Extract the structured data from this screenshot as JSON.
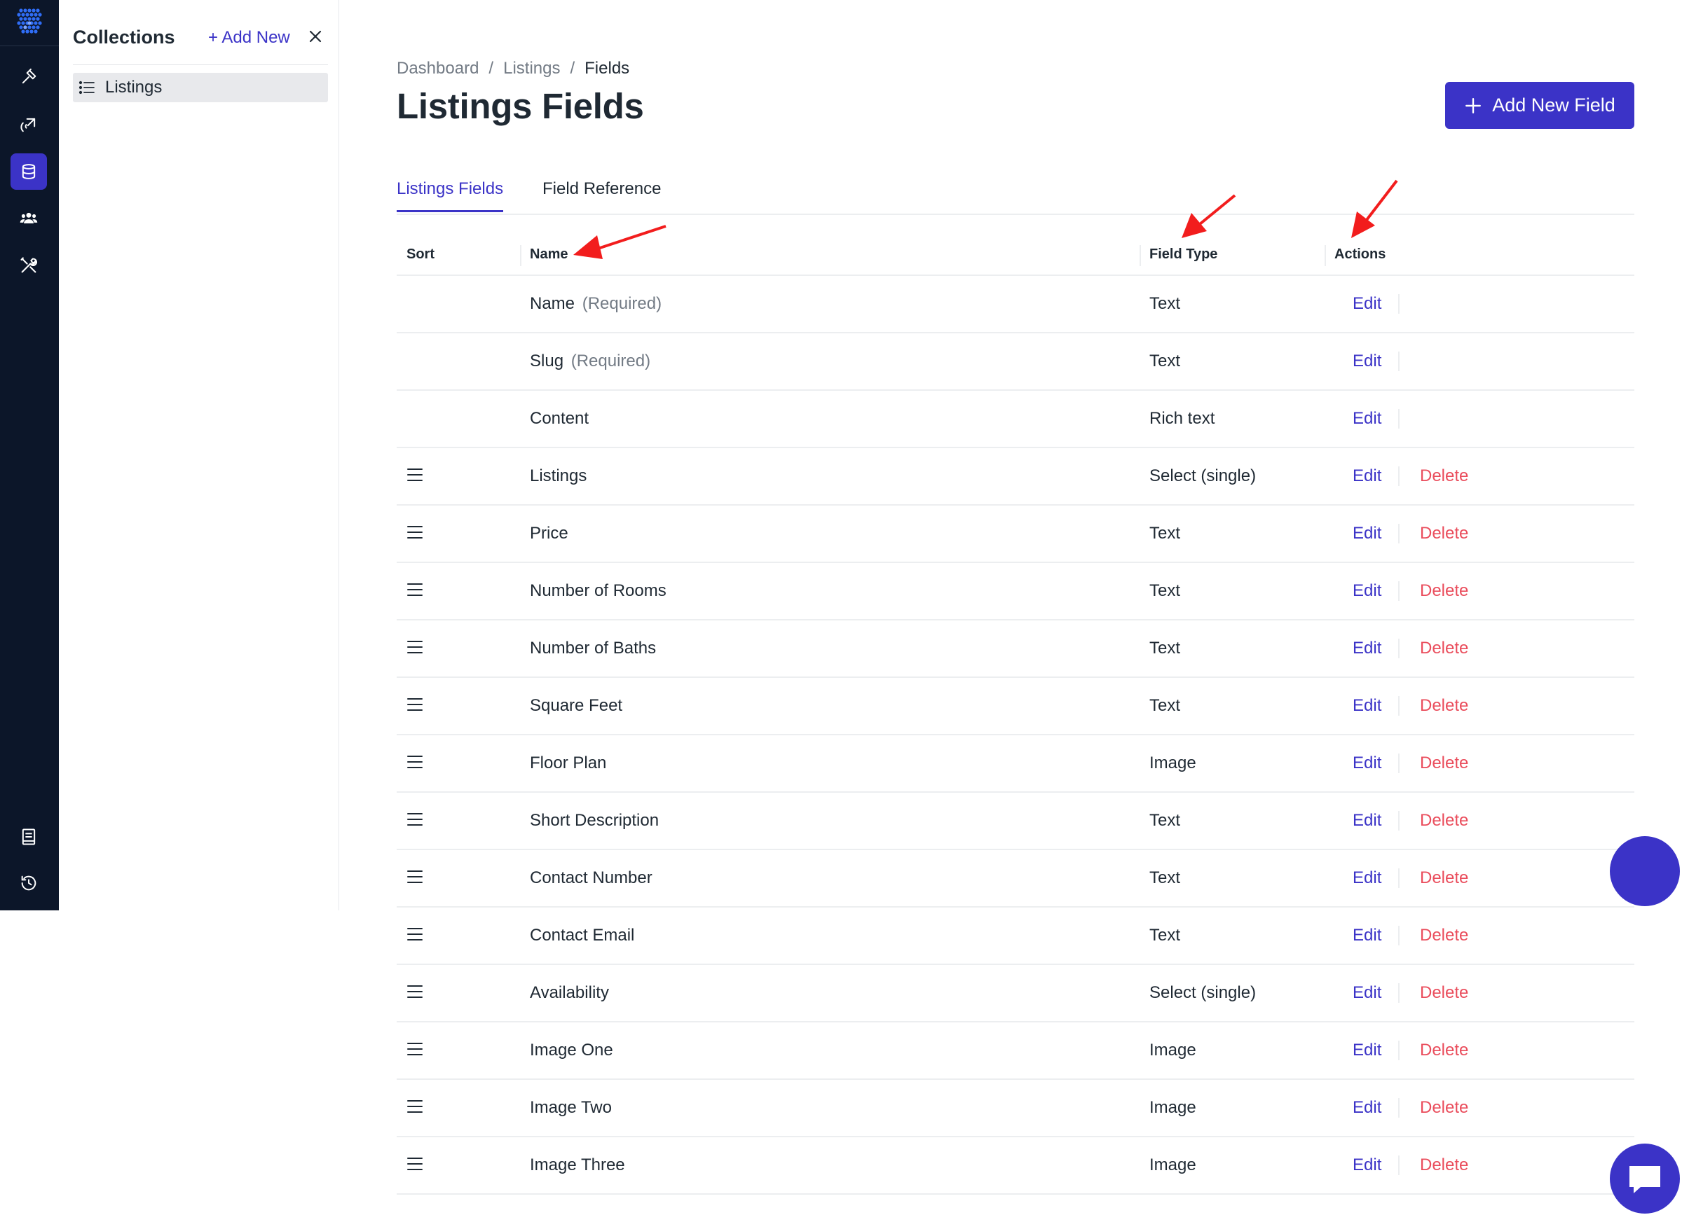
{
  "sidebar": {
    "title": "Collections",
    "add_label": "+ Add New",
    "items": [
      {
        "label": "Listings"
      }
    ]
  },
  "breadcrumb": [
    "Dashboard",
    "/",
    "Listings",
    "/",
    "Fields"
  ],
  "page": {
    "title": "Listings Fields",
    "add_button_label": "Add New Field"
  },
  "tabs": [
    {
      "label": "Listings Fields",
      "active": true
    },
    {
      "label": "Field Reference",
      "active": false
    }
  ],
  "table": {
    "headers": {
      "sort": "Sort",
      "name": "Name",
      "type": "Field Type",
      "actions": "Actions"
    },
    "edit_label": "Edit",
    "delete_label": "Delete",
    "rows": [
      {
        "name": "Name",
        "required": "(Required)",
        "type": "Text",
        "sortable": false
      },
      {
        "name": "Slug",
        "required": "(Required)",
        "type": "Text",
        "sortable": false
      },
      {
        "name": "Content",
        "required": "",
        "type": "Rich text",
        "sortable": false
      },
      {
        "name": "Listings",
        "required": "",
        "type": "Select (single)",
        "sortable": true
      },
      {
        "name": "Price",
        "required": "",
        "type": "Text",
        "sortable": true
      },
      {
        "name": "Number of Rooms",
        "required": "",
        "type": "Text",
        "sortable": true
      },
      {
        "name": "Number of Baths",
        "required": "",
        "type": "Text",
        "sortable": true
      },
      {
        "name": "Square Feet",
        "required": "",
        "type": "Text",
        "sortable": true
      },
      {
        "name": "Floor Plan",
        "required": "",
        "type": "Image",
        "sortable": true
      },
      {
        "name": "Short Description",
        "required": "",
        "type": "Text",
        "sortable": true
      },
      {
        "name": "Contact Number",
        "required": "",
        "type": "Text",
        "sortable": true
      },
      {
        "name": "Contact Email",
        "required": "",
        "type": "Text",
        "sortable": true
      },
      {
        "name": "Availability",
        "required": "",
        "type": "Select (single)",
        "sortable": true
      },
      {
        "name": "Image One",
        "required": "",
        "type": "Image",
        "sortable": true
      },
      {
        "name": "Image Two",
        "required": "",
        "type": "Image",
        "sortable": true
      },
      {
        "name": "Image Three",
        "required": "",
        "type": "Image",
        "sortable": true
      }
    ]
  },
  "rail_icons": [
    "hammer-icon",
    "rocket-icon",
    "database-icon",
    "users-icon",
    "tools-icon",
    "book-icon",
    "history-icon"
  ],
  "colors": {
    "accent": "#3b33c7",
    "danger": "#ea4d5c",
    "rail": "#0c1629",
    "annotation": "#f21d1d"
  }
}
